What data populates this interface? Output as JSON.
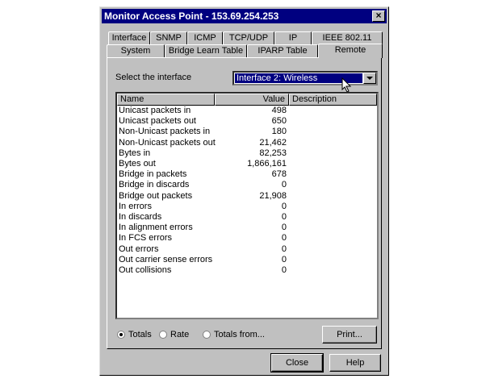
{
  "window": {
    "title": "Monitor Access Point - 153.69.254.253",
    "close_glyph": "×"
  },
  "tabs": {
    "row1": [
      "Interface",
      "SNMP",
      "ICMP",
      "TCP/UDP",
      "IP",
      "IEEE 802.11"
    ],
    "row2": [
      "System",
      "Bridge Learn Table",
      "IPARP Table",
      "Remote"
    ],
    "active": "Remote"
  },
  "select": {
    "label": "Select the interface",
    "value": "Interface 2: Wireless"
  },
  "table": {
    "headers": {
      "name": "Name",
      "value": "Value",
      "description": "Description"
    },
    "rows": [
      {
        "name": "Unicast packets in",
        "value": "498"
      },
      {
        "name": "Unicast packets out",
        "value": "650"
      },
      {
        "name": "Non-Unicast packets in",
        "value": "180"
      },
      {
        "name": "Non-Unicast packets out",
        "value": "21,462"
      },
      {
        "name": "Bytes in",
        "value": "82,253"
      },
      {
        "name": "Bytes out",
        "value": "1,866,161"
      },
      {
        "name": "Bridge in packets",
        "value": "678"
      },
      {
        "name": "Bridge in discards",
        "value": "0"
      },
      {
        "name": "Bridge out packets",
        "value": "21,908"
      },
      {
        "name": "In errors",
        "value": "0"
      },
      {
        "name": "In discards",
        "value": "0"
      },
      {
        "name": "In alignment errors",
        "value": "0"
      },
      {
        "name": "In FCS errors",
        "value": "0"
      },
      {
        "name": "Out errors",
        "value": "0"
      },
      {
        "name": "Out carrier sense errors",
        "value": "0"
      },
      {
        "name": "Out collisions",
        "value": "0"
      }
    ]
  },
  "radios": [
    {
      "label": "Totals",
      "checked": true
    },
    {
      "label": "Rate",
      "checked": false
    },
    {
      "label": "Totals from...",
      "checked": false
    }
  ],
  "buttons": {
    "print": "Print...",
    "close": "Close",
    "help": "Help"
  }
}
